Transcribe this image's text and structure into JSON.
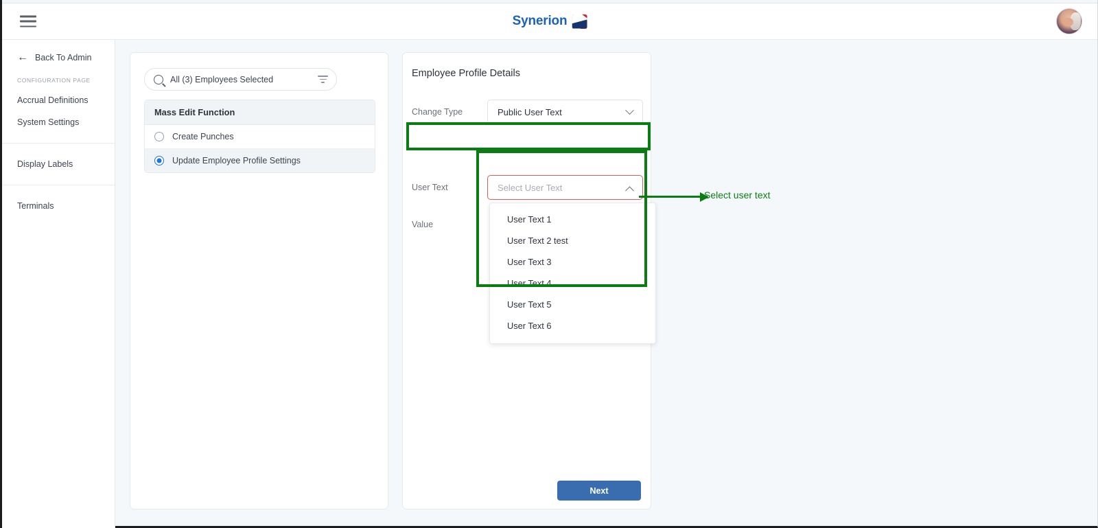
{
  "header": {
    "menu_icon": "hamburger-menu-icon",
    "brand_name": "Synerion",
    "brand_color": "#1d62b3",
    "avatar_icon": "user-avatar"
  },
  "sidebar": {
    "back_label": "Back To Admin",
    "back_icon": "arrow-left-icon",
    "section_label": "CONFIGURATION PAGE",
    "group_one": [
      {
        "label": "Accrual Definitions"
      },
      {
        "label": "System Settings"
      }
    ],
    "group_two": [
      {
        "label": "Display Labels"
      }
    ],
    "group_three": [
      {
        "label": "Terminals"
      }
    ]
  },
  "employee_panel": {
    "search": {
      "icon": "search-icon",
      "value": "All (3) Employees Selected",
      "placeholder": "Search employees",
      "filter_icon": "filter-icon"
    },
    "mass_edit": {
      "header": "Mass Edit Function",
      "options": [
        {
          "label": "Create Punches",
          "selected": false
        },
        {
          "label": "Update Employee Profile Settings",
          "selected": true
        }
      ]
    }
  },
  "profile_panel": {
    "title": "Employee Profile Details",
    "change_type": {
      "label": "Change Type",
      "value": "Public User Text",
      "chevron": "chevron-down-icon"
    },
    "user_text": {
      "label": "User Text",
      "placeholder": "Select User Text",
      "chevron": "chevron-up-icon",
      "error_color": "#e05a5a",
      "options": [
        "User Text 1",
        "User Text 2 test",
        "User Text 3",
        "User Text 4",
        "User Text 5",
        "User Text 6"
      ]
    },
    "value": {
      "label": "Value"
    },
    "next_label": "Next",
    "next_color": "#3a6db0"
  },
  "annotation": {
    "text": "Select user text",
    "color": "#0a7d12"
  }
}
